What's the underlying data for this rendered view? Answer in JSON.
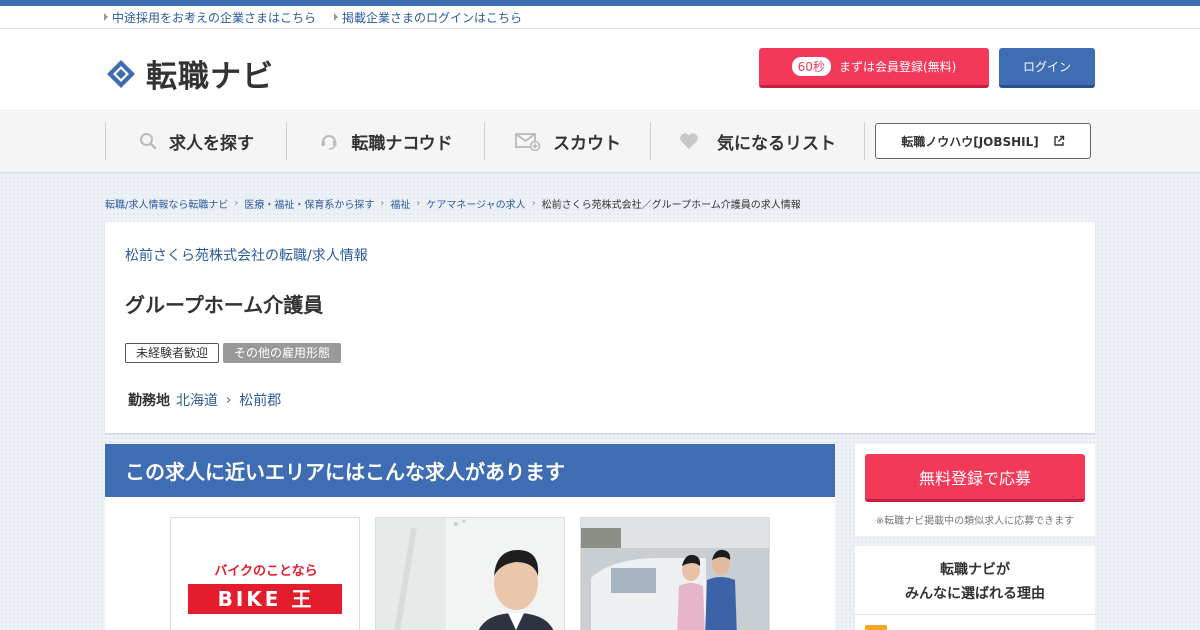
{
  "utility_links": [
    "中途採用をお考えの企業さまはこちら",
    "掲載企業さまのログインはこちら"
  ],
  "header": {
    "logo_text": "転職ナビ",
    "register_badge": "60秒",
    "register_label": "まずは会員登録(無料)",
    "login_label": "ログイン"
  },
  "gnav": {
    "items": [
      {
        "label": "求人を探す",
        "icon": "search-icon"
      },
      {
        "label": "転職ナコウド",
        "icon": "headset-icon"
      },
      {
        "label": "スカウト",
        "icon": "mail-plus-icon"
      },
      {
        "label": "気になるリスト",
        "icon": "heart-icon"
      }
    ],
    "knowhow_label": "転職ノウハウ[JOBSHIL]"
  },
  "breadcrumb": [
    "転職/求人情報なら転職ナビ",
    "医療・福祉・保育系から探す",
    "福祉",
    "ケアマネージャの求人",
    "松前さくら苑株式会社／グループホーム介護員の求人情報"
  ],
  "job": {
    "company_link": "松前さくら苑株式会社の転職/求人情報",
    "title": "グループホーム介護員",
    "tags": [
      "未経験者歓迎",
      "その他の雇用形態"
    ],
    "location_label": "勤務地",
    "prefecture": "北海道",
    "city": "松前郡"
  },
  "similar": {
    "heading": "この求人に近いエリアにはこんな求人があります",
    "thumb1_caption": "バイクのことなら",
    "thumb1_brand": "BIKE 王"
  },
  "sidebar": {
    "apply_label": "無料登録で応募",
    "apply_note": "※転職ナビ掲載中の類似求人に応募できます",
    "reason_line1": "転職ナビが",
    "reason_line2": "みんなに選ばれる理由"
  },
  "colors": {
    "brand_blue": "#3e6db4",
    "accent_red": "#f2395a",
    "link": "#2d5b9c"
  }
}
